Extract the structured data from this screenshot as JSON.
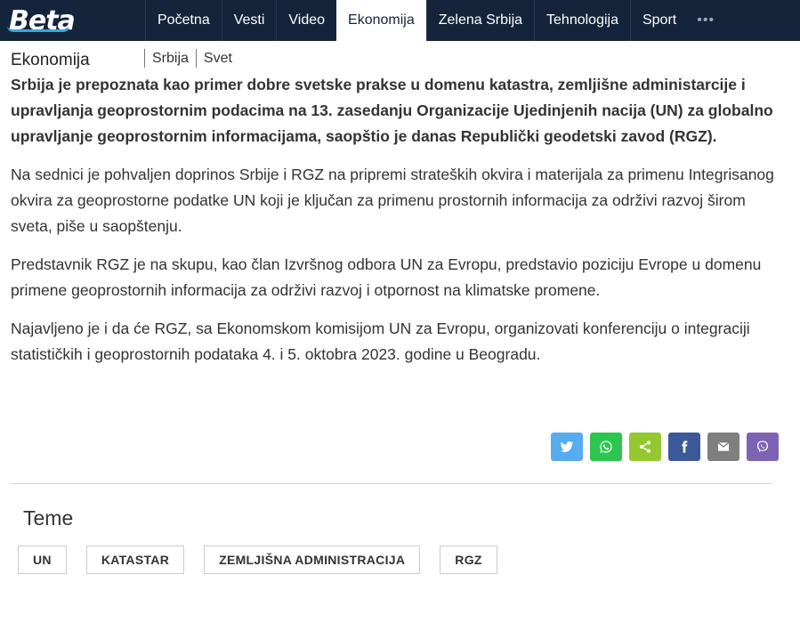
{
  "header": {
    "logo_text": "Beta",
    "nav": [
      {
        "label": "Početna",
        "active": false
      },
      {
        "label": "Vesti",
        "active": false
      },
      {
        "label": "Video",
        "active": false
      },
      {
        "label": "Ekonomija",
        "active": true
      },
      {
        "label": "Zelena Srbija",
        "active": false
      },
      {
        "label": "Tehnologija",
        "active": false
      },
      {
        "label": "Sport",
        "active": false
      }
    ],
    "more_label": "•••"
  },
  "subheader": {
    "section_title": "Ekonomija",
    "links": [
      "Srbija",
      "Svet"
    ]
  },
  "article": {
    "lead": "Srbija je prepoznata kao primer dobre svetske prakse u domenu katastra, zemljišne administarcije i upravljanja geoprostornim podacima na 13. zasedanju Organizacije Ujedinjenih nacija (UN) za globalno upravljanje geoprostornim informacijama, saopštio je danas Republički geodetski zavod (RGZ).",
    "paragraphs": [
      "Na sednici je pohvaljen doprinos Srbije i RGZ na pripremi strateških okvira i materijala za primenu Integrisanog okvira za geoprostorne podatke UN koji je ključan za primenu prostornih informacija za održivi razvoj širom sveta, piše u saopštenju.",
      "Predstavnik RGZ je na skupu, kao član Izvršnog odbora UN za Evropu, predstavio poziciju Evrope u domenu primene geoprostornih informacija za održivi razvoj i otpornost na klimatske promene.",
      "Najavljeno je i da će RGZ, sa Ekonomskom komisijom UN za Evropu, organizovati konferenciju o integraciji statističkih i geoprostornih podataka 4. i 5. oktobra 2023. godine u Beogradu."
    ]
  },
  "share": [
    {
      "icon": "twitter-icon",
      "color": "#55acee"
    },
    {
      "icon": "whatsapp-icon",
      "color": "#2cc64e"
    },
    {
      "icon": "share-icon",
      "color": "#95c730"
    },
    {
      "icon": "facebook-icon",
      "color": "#3b5998"
    },
    {
      "icon": "email-icon",
      "color": "#7f7f7f"
    },
    {
      "icon": "viber-icon",
      "color": "#7d63b3"
    }
  ],
  "teme": {
    "title": "Teme",
    "tags": [
      "UN",
      "KATASTAR",
      "ZEMLJIŠNA ADMINISTRACIJA",
      "RGZ"
    ]
  }
}
